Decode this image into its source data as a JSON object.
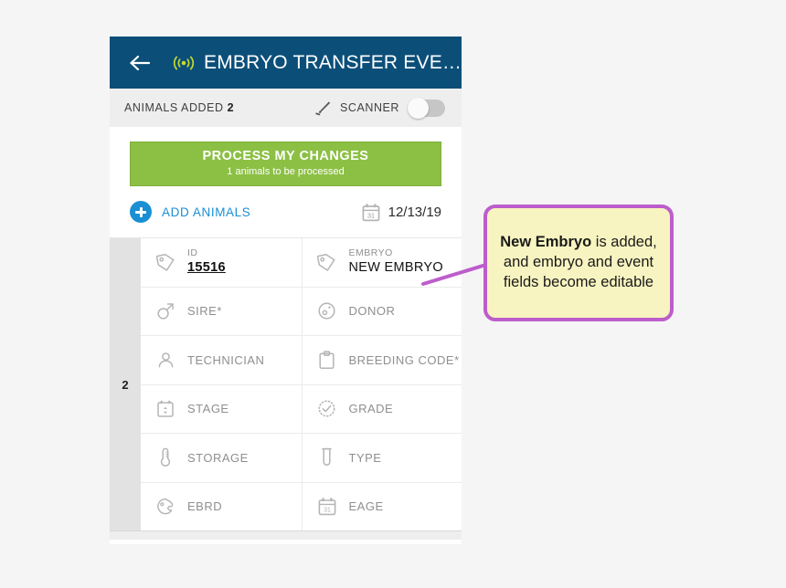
{
  "appbar": {
    "back_icon": "arrow-left-icon",
    "rfid_icon": "rfid-broadcast-icon",
    "title": "EMBRYO TRANSFER EVE…",
    "bg_color": "#0b4f79",
    "rfid_color": "#c6d92e"
  },
  "scanbar": {
    "animals_added_label": "ANIMALS ADDED",
    "animals_added_count": "2",
    "scanner_icon": "scanner-wand-icon",
    "scanner_label": "SCANNER",
    "toggle_state": "off"
  },
  "actions": {
    "process_button": {
      "title": "PROCESS MY CHANGES",
      "subtitle": "1 animals to be processed",
      "color": "#8cc044"
    },
    "add_animals": {
      "icon": "plus-circle-icon",
      "label": "ADD ANIMALS",
      "color": "#1a8fd4"
    },
    "date": {
      "icon": "calendar-icon",
      "icon_day": "31",
      "value": "12/13/19"
    }
  },
  "table": {
    "gutter_number": "2",
    "rows": [
      {
        "left": {
          "icon": "tag-icon",
          "label": "ID",
          "value": "15516",
          "value_style": "bold-underline"
        },
        "right": {
          "icon": "tag-icon",
          "label": "EMBRYO",
          "value": "NEW EMBRYO",
          "value_style": "plain"
        }
      },
      {
        "left": {
          "icon": "male-sign-icon",
          "label": "SIRE*",
          "value": "",
          "value_style": "none"
        },
        "right": {
          "icon": "oocyte-icon",
          "label": "DONOR",
          "value": "",
          "value_style": "none"
        }
      },
      {
        "left": {
          "icon": "person-icon",
          "label": "TECHNICIAN",
          "value": "",
          "value_style": "none"
        },
        "right": {
          "icon": "clipboard-icon",
          "label": "BREEDING CODE*",
          "value": "",
          "value_style": "none"
        }
      },
      {
        "left": {
          "icon": "stage-box-icon",
          "label": "STAGE",
          "value": "",
          "value_style": "none"
        },
        "right": {
          "icon": "check-badge-icon",
          "label": "GRADE",
          "value": "",
          "value_style": "none"
        }
      },
      {
        "left": {
          "icon": "thermometer-icon",
          "label": "STORAGE",
          "value": "",
          "value_style": "none"
        },
        "right": {
          "icon": "test-tube-icon",
          "label": "TYPE",
          "value": "",
          "value_style": "none"
        }
      },
      {
        "left": {
          "icon": "embryo-icon",
          "label": "EBRD",
          "value": "",
          "value_style": "none"
        },
        "right": {
          "icon": "calendar-icon",
          "label": "EAGE",
          "value": "",
          "value_style": "none"
        }
      }
    ]
  },
  "annotation": {
    "bold_text": "New Embryo",
    "rest_text": " is added, and embryo and event fields become editable",
    "fill_color": "#f8f4c1",
    "border_color": "#bd5dcb",
    "leader_color": "#bd5dcb"
  }
}
